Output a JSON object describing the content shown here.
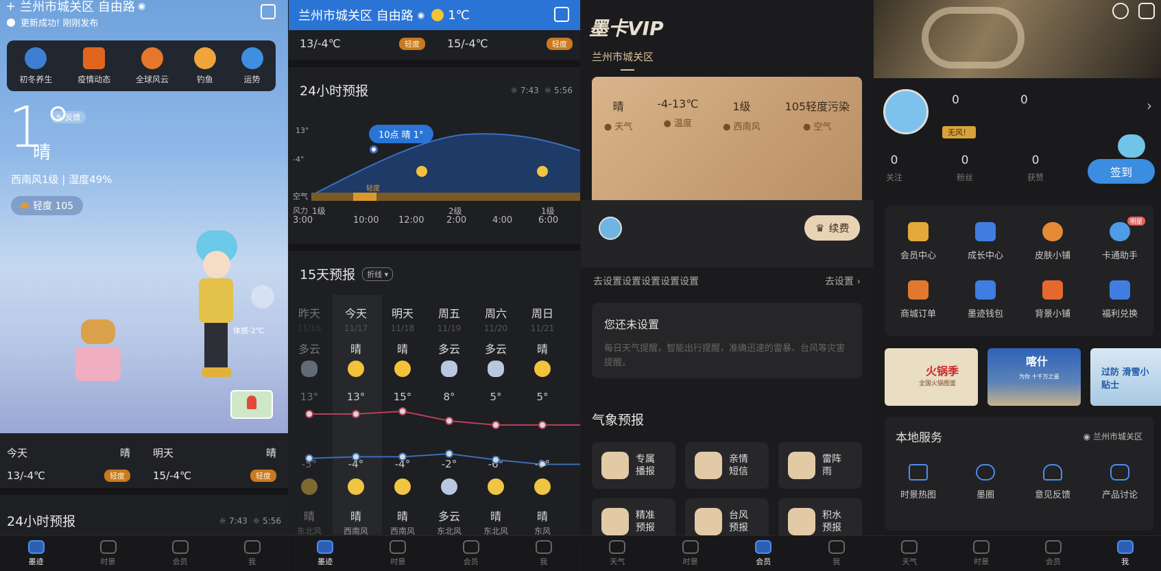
{
  "p1": {
    "location": "兰州市城关区 自由路",
    "update_status": "更新成功! 刚刚发布",
    "features": [
      {
        "label": "初冬养生",
        "icon": "herb-icon"
      },
      {
        "label": "疫情动态",
        "icon": "virus-icon"
      },
      {
        "label": "全球风云",
        "icon": "globe-icon"
      },
      {
        "label": "钓鱼",
        "icon": "fish-icon"
      },
      {
        "label": "运势",
        "icon": "fortune-icon"
      }
    ],
    "temperature": "1°",
    "feedback": "反馈",
    "condition": "晴",
    "wind_humidity": "西南风1级 | 湿度49%",
    "aqi": "轻度 105",
    "feels_like": "体感-2℃",
    "today": {
      "label": "今天",
      "cond": "晴",
      "range": "13/-4℃",
      "aqi": "轻度"
    },
    "tomorrow": {
      "label": "明天",
      "cond": "晴",
      "range": "15/-4℃",
      "aqi": "轻度"
    },
    "hourly_title": "24小时预报",
    "sunrise": "7:43",
    "sunset": "5:56"
  },
  "p2": {
    "location": "兰州市城关区 自由路",
    "temp": "1℃",
    "today_range": "13/-4℃",
    "today_aqi": "轻度",
    "tomorrow_range": "15/-4℃",
    "tomorrow_aqi": "轻度",
    "hourly_title": "24小时预报",
    "sunrise": "7:43",
    "sunset": "5:56",
    "axis_high": "13°",
    "axis_low": "-4°",
    "tooltip": "10点 晴 1°",
    "air_label": "空气",
    "air_value": "轻度",
    "wind_label": "风力",
    "wind_levels": [
      "1级",
      "2级",
      "1级"
    ],
    "times": [
      "3:00",
      "10:00",
      "12:00",
      "2:00",
      "4:00",
      "6:00"
    ],
    "daily_title": "15天预报",
    "daily_mode": "折线",
    "days": [
      {
        "name": "昨天",
        "date": "11/16",
        "day_cond": "多云",
        "high": "13°",
        "low": "-5°",
        "night_cond": "晴",
        "wind": "东北风"
      },
      {
        "name": "今天",
        "date": "11/17",
        "day_cond": "晴",
        "high": "13°",
        "low": "-4°",
        "night_cond": "晴",
        "wind": "西南风"
      },
      {
        "name": "明天",
        "date": "11/18",
        "day_cond": "晴",
        "high": "15°",
        "low": "-4°",
        "night_cond": "晴",
        "wind": "西南风"
      },
      {
        "name": "周五",
        "date": "11/19",
        "day_cond": "多云",
        "high": "8°",
        "low": "-2°",
        "night_cond": "多云",
        "wind": "东北风"
      },
      {
        "name": "周六",
        "date": "11/20",
        "day_cond": "多云",
        "high": "5°",
        "low": "-6°",
        "night_cond": "晴",
        "wind": "东北风"
      },
      {
        "name": "周日",
        "date": "11/21",
        "day_cond": "晴",
        "high": "5°",
        "low": "-9°",
        "night_cond": "晴",
        "wind": "东风"
      }
    ]
  },
  "p3": {
    "brand": "墨卡VIP",
    "location": "兰州市城关区",
    "card": [
      {
        "value": "晴",
        "label": "天气"
      },
      {
        "value": "-4-13℃",
        "label": "温度"
      },
      {
        "value": "1级",
        "label": "西南风"
      },
      {
        "value": "105轻度污染",
        "label": "空气"
      }
    ],
    "renew": "续费",
    "setting_row": "去设置设置设置设置设置",
    "go_setting": "去设置",
    "notset_title": "您还未设置",
    "notset_desc": "每日天气提醒，智能出行提醒，准确迅速的雷暴、台风等灾害提醒。",
    "section_title": "气象预报",
    "services": [
      "专属播报",
      "亲情短信",
      "雷阵雨",
      "精准预报",
      "台风预报",
      "积水预报"
    ]
  },
  "p4": {
    "count_1": "0",
    "count_2": "0",
    "tag": "无风！",
    "stats": [
      {
        "value": "0",
        "label": "关注"
      },
      {
        "value": "0",
        "label": "粉丝"
      },
      {
        "value": "0",
        "label": "获赞"
      }
    ],
    "checkin": "签到",
    "grid": [
      {
        "label": "会员中心",
        "icon": "crown-icon"
      },
      {
        "label": "成长中心",
        "icon": "medal-icon"
      },
      {
        "label": "皮肤小铺",
        "icon": "skin-icon"
      },
      {
        "label": "卡通助手",
        "icon": "cartoon-icon",
        "tag": "明星"
      },
      {
        "label": "商城订单",
        "icon": "truck-icon"
      },
      {
        "label": "墨迹钱包",
        "icon": "wallet-icon"
      },
      {
        "label": "背景小铺",
        "icon": "shop-icon"
      },
      {
        "label": "福利兑换",
        "icon": "gift-icon"
      }
    ],
    "banners": [
      {
        "text": "火锅季",
        "sub": "全国火锅图鉴"
      },
      {
        "text": "喀什",
        "sub": "为你 十千万之遥"
      },
      {
        "text": "过防 滑雪小贴士",
        "sub": ""
      }
    ],
    "local_title": "本地服务",
    "local_location": "兰州市城关区",
    "local_items": [
      "时景热图",
      "墨圈",
      "意见反馈",
      "产品讨论"
    ]
  },
  "nav": {
    "p1": [
      "墨迹",
      "时景",
      "会员",
      "我"
    ],
    "p2": [
      "墨迹",
      "时景",
      "会员",
      "我"
    ],
    "p3": [
      "天气",
      "时景",
      "会员",
      "我"
    ],
    "p4": [
      "天气",
      "时景",
      "会员",
      "我"
    ]
  },
  "chart_data": {
    "type": "line",
    "categories": [
      "11/16",
      "11/17",
      "11/18",
      "11/19",
      "11/20",
      "11/21"
    ],
    "series": [
      {
        "values": [
          13,
          13,
          15,
          8,
          5,
          5
        ]
      },
      {
        "values": [
          -5,
          -4,
          -4,
          -2,
          -6,
          -9
        ]
      }
    ]
  }
}
